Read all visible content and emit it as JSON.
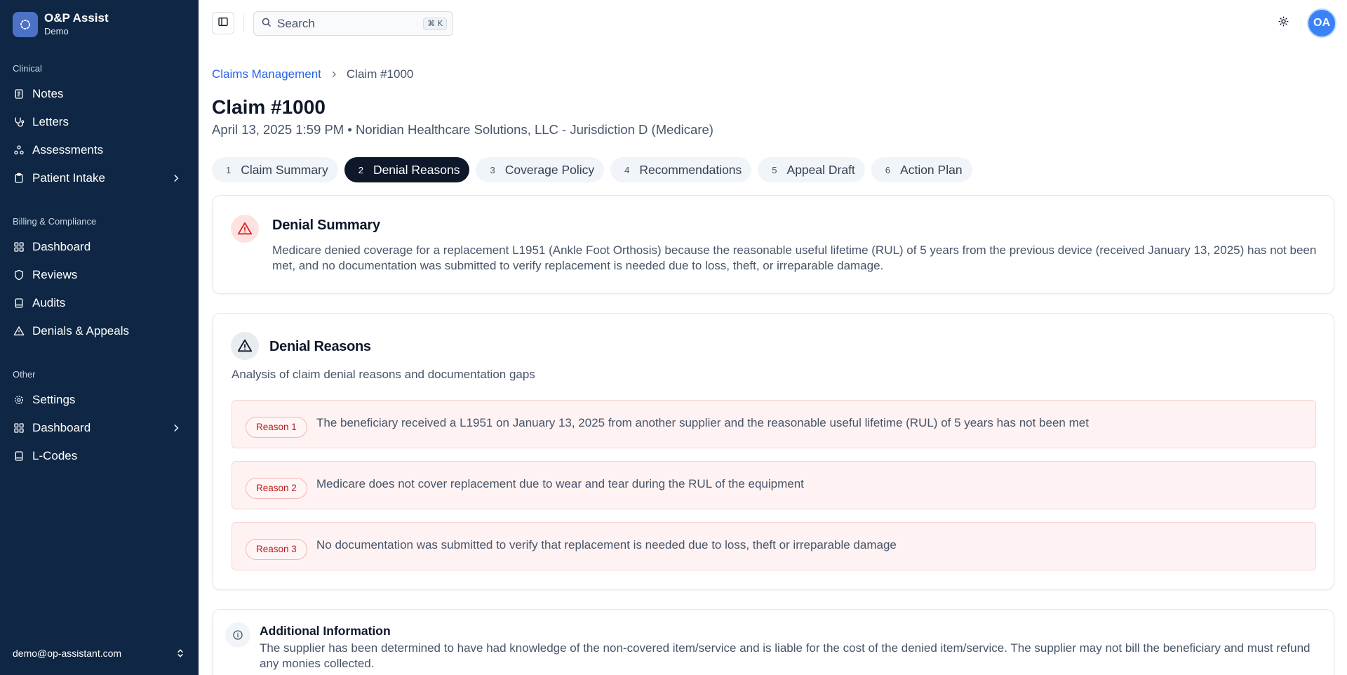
{
  "app": {
    "name": "O&P Assist",
    "subtitle": "Demo"
  },
  "sidebar": {
    "sections": [
      {
        "label": "Clinical",
        "items": [
          {
            "label": "Notes",
            "icon": "note-icon"
          },
          {
            "label": "Letters",
            "icon": "stethoscope-icon"
          },
          {
            "label": "Assessments",
            "icon": "network-icon"
          },
          {
            "label": "Patient Intake",
            "icon": "clipboard-icon",
            "has_submenu": true
          }
        ]
      },
      {
        "label": "Billing & Compliance",
        "items": [
          {
            "label": "Dashboard",
            "icon": "grid-icon"
          },
          {
            "label": "Reviews",
            "icon": "shield-icon"
          },
          {
            "label": "Audits",
            "icon": "book-icon"
          },
          {
            "label": "Denials & Appeals",
            "icon": "warning-icon"
          }
        ]
      },
      {
        "label": "Other",
        "items": [
          {
            "label": "Settings",
            "icon": "gear-icon"
          },
          {
            "label": "Dashboard",
            "icon": "grid-icon",
            "has_submenu": true
          },
          {
            "label": "L-Codes",
            "icon": "book-icon"
          }
        ]
      }
    ],
    "footer_email": "demo@op-assistant.com"
  },
  "topbar": {
    "search_placeholder": "Search",
    "search_shortcut": "⌘ K",
    "avatar_initials": "OA"
  },
  "breadcrumb": {
    "parent": "Claims Management",
    "current": "Claim #1000"
  },
  "claim": {
    "title": "Claim #1000",
    "subtitle": "April 13, 2025 1:59 PM • Noridian Healthcare Solutions, LLC - Jurisdiction D (Medicare)"
  },
  "tabs": [
    {
      "num": "1",
      "label": "Claim Summary",
      "active": false
    },
    {
      "num": "2",
      "label": "Denial Reasons",
      "active": true
    },
    {
      "num": "3",
      "label": "Coverage Policy",
      "active": false
    },
    {
      "num": "4",
      "label": "Recommendations",
      "active": false
    },
    {
      "num": "5",
      "label": "Appeal Draft",
      "active": false
    },
    {
      "num": "6",
      "label": "Action Plan",
      "active": false
    }
  ],
  "denial_summary": {
    "title": "Denial Summary",
    "body": "Medicare denied coverage for a replacement L1951 (Ankle Foot Orthosis) because the reasonable useful lifetime (RUL) of 5 years from the previous device (received January 13, 2025) has not been met, and no documentation was submitted to verify replacement is needed due to loss, theft, or irreparable damage."
  },
  "denial_reasons": {
    "title": "Denial Reasons",
    "subtitle": "Analysis of claim denial reasons and documentation gaps",
    "reasons": [
      {
        "badge": "Reason 1",
        "text": "The beneficiary received a L1951 on January 13, 2025 from another supplier and the reasonable useful lifetime (RUL) of 5 years has not been met"
      },
      {
        "badge": "Reason 2",
        "text": "Medicare does not cover replacement due to wear and tear during the RUL of the equipment"
      },
      {
        "badge": "Reason 3",
        "text": "No documentation was submitted to verify that replacement is needed due to loss, theft or irreparable damage"
      }
    ]
  },
  "additional_info": {
    "title": "Additional Information",
    "body": "The supplier has been determined to have had knowledge of the non-covered item/service and is liable for the cost of the denied item/service. The supplier may not bill the beneficiary and must refund any monies collected."
  },
  "colors": {
    "sidebar_bg": "#0f2744",
    "accent_blue": "#2563eb",
    "active_tab": "#0f172a",
    "reason_bg": "#fef2f2",
    "reason_badge_text": "#b91c1c"
  }
}
